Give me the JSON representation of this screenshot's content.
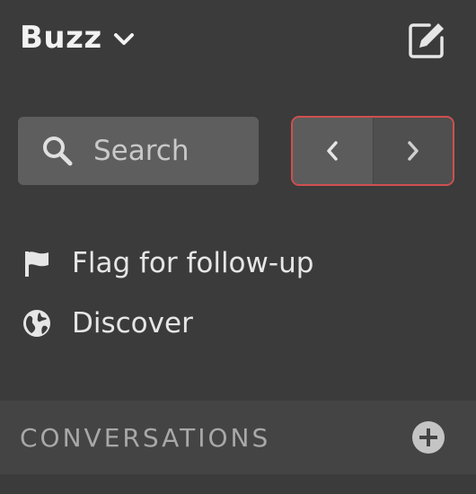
{
  "workspace": {
    "name": "Buzz"
  },
  "search": {
    "placeholder": "Search"
  },
  "nav": {
    "items": [
      {
        "label": "Flag for follow-up",
        "icon": "flag-icon"
      },
      {
        "label": "Discover",
        "icon": "globe-icon"
      }
    ]
  },
  "sections": {
    "conversations": {
      "title": "CONVERSATIONS"
    }
  },
  "colors": {
    "background": "#3b3b3b",
    "search_bg": "#5e5e5e",
    "focus_ring": "#d0504f",
    "section_bg": "#444444"
  }
}
